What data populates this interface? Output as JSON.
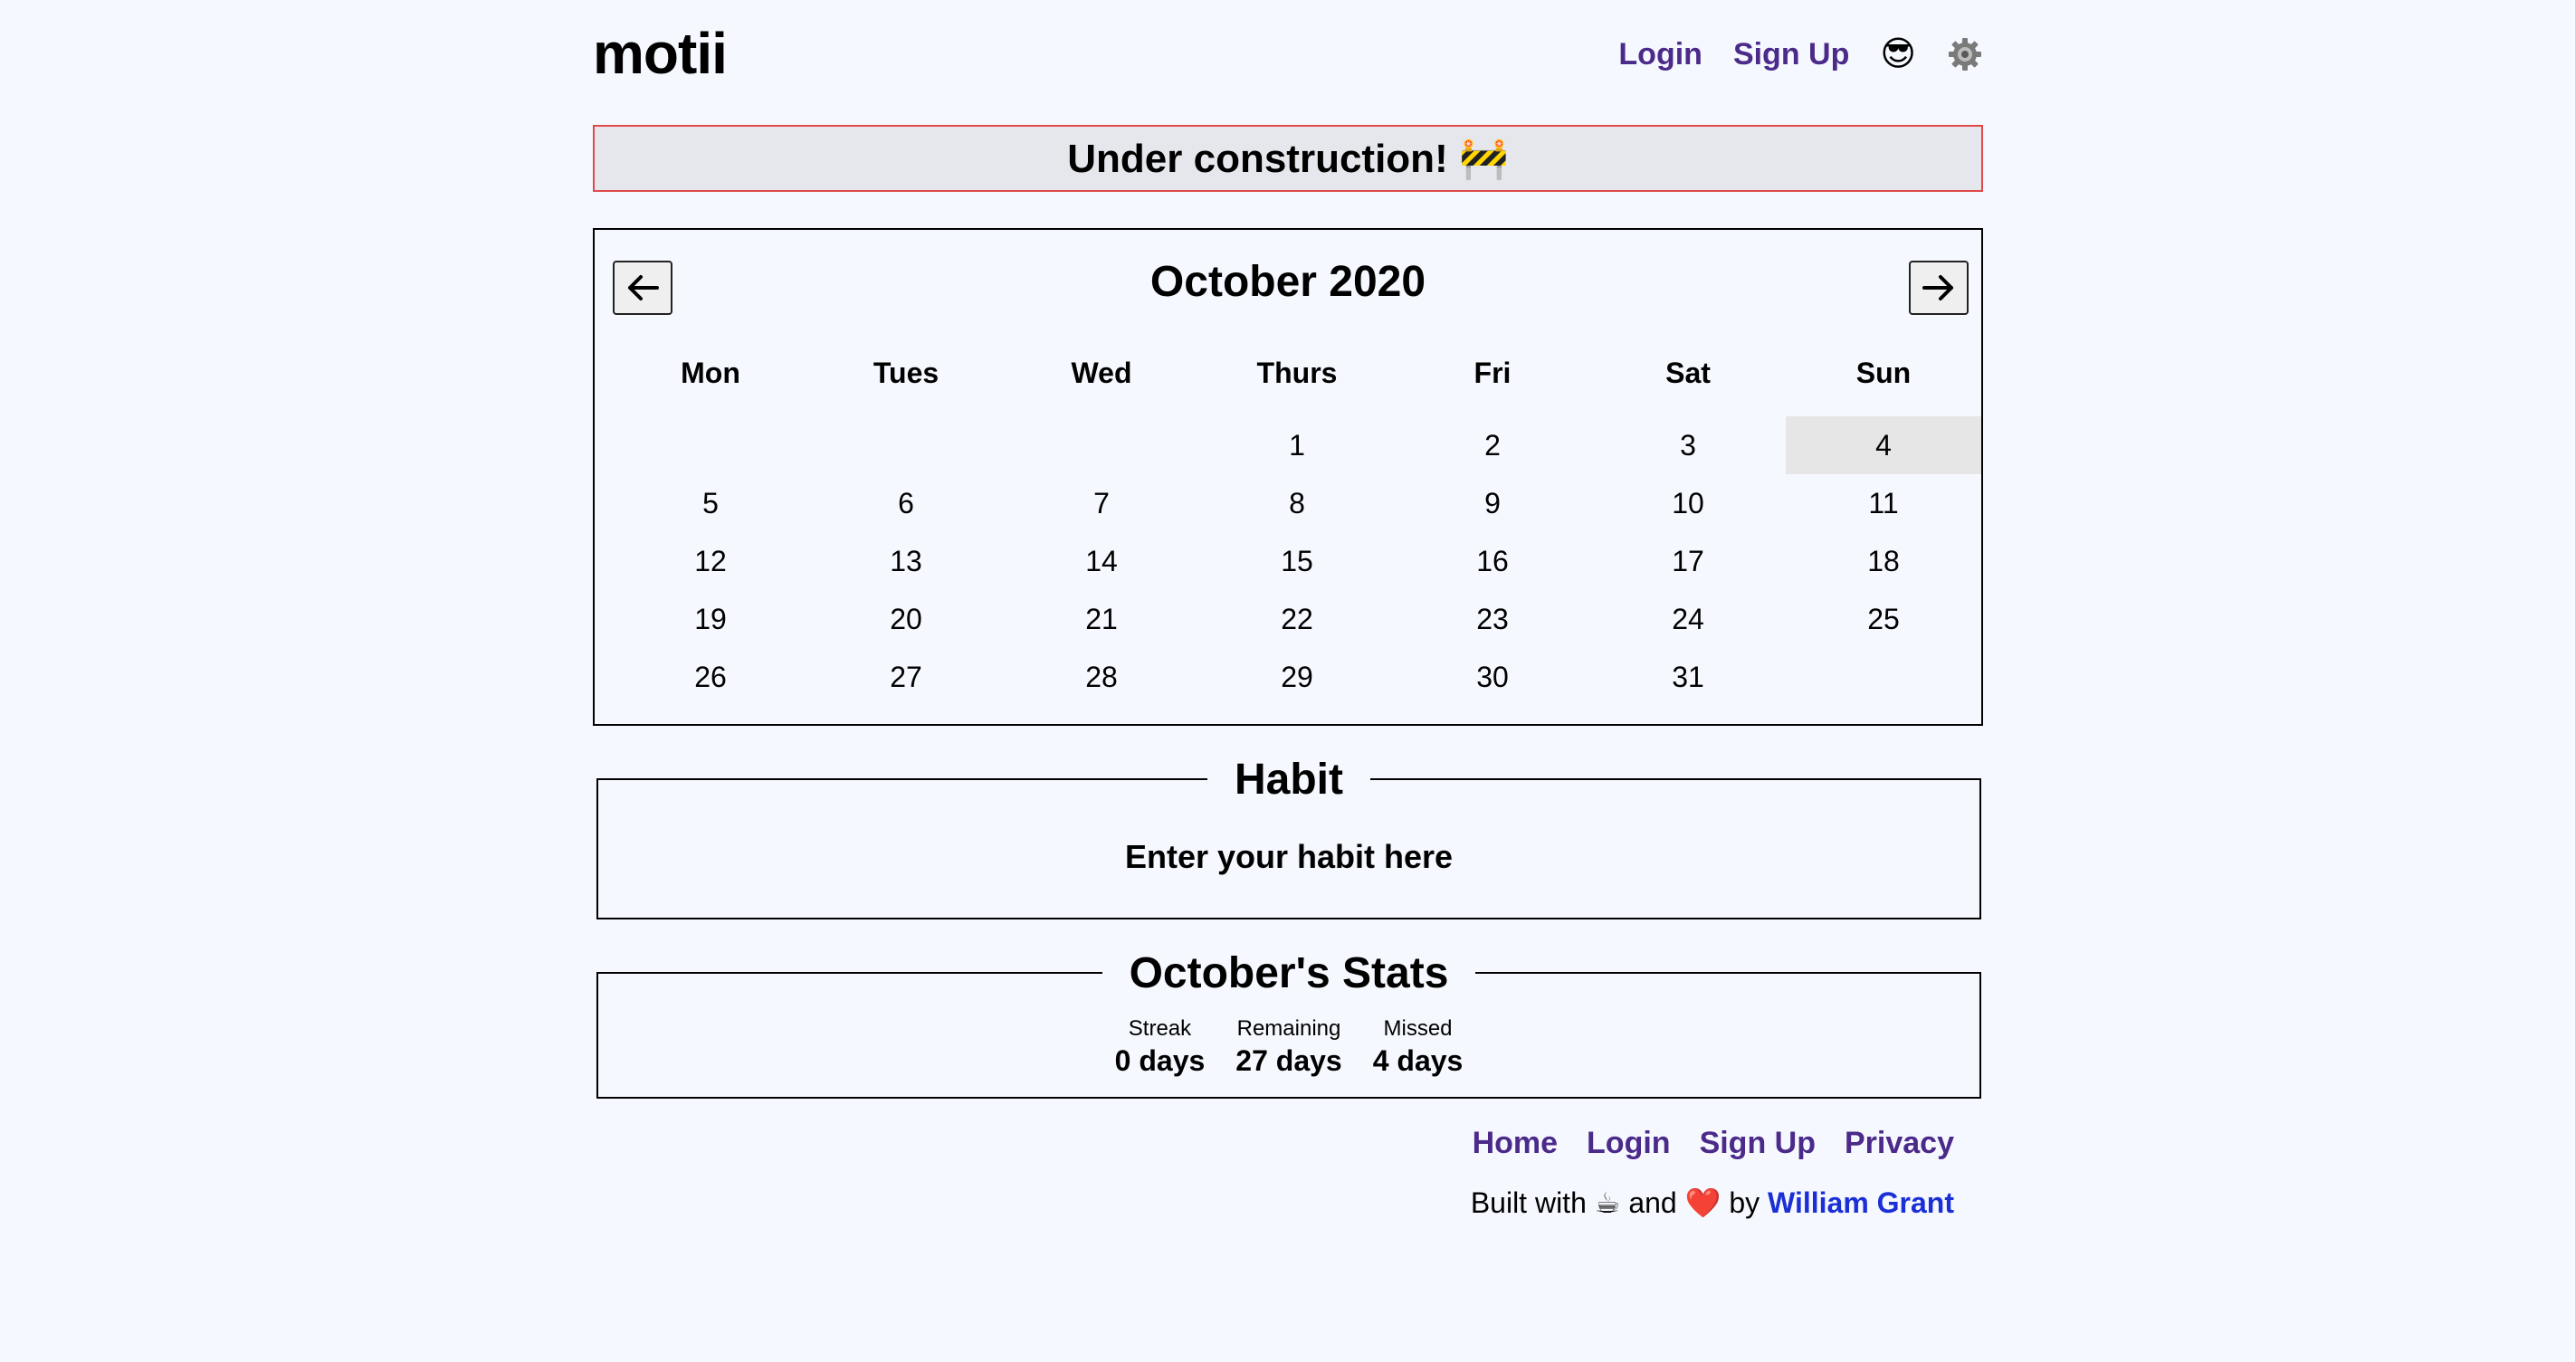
{
  "header": {
    "brand": "motii",
    "nav": {
      "login": "Login",
      "signup": "Sign Up",
      "theme_emoji": "😎",
      "settings_icon": "gear-icon"
    }
  },
  "banner": {
    "text": "Under construction! 🚧"
  },
  "calendar": {
    "title": "October 2020",
    "prev_icon": "arrow-left-icon",
    "next_icon": "arrow-right-icon",
    "weekdays": [
      "Mon",
      "Tues",
      "Wed",
      "Thurs",
      "Fri",
      "Sat",
      "Sun"
    ],
    "weeks": [
      [
        "",
        "",
        "",
        "1",
        "2",
        "3",
        "4"
      ],
      [
        "5",
        "6",
        "7",
        "8",
        "9",
        "10",
        "11"
      ],
      [
        "12",
        "13",
        "14",
        "15",
        "16",
        "17",
        "18"
      ],
      [
        "19",
        "20",
        "21",
        "22",
        "23",
        "24",
        "25"
      ],
      [
        "26",
        "27",
        "28",
        "29",
        "30",
        "31",
        ""
      ]
    ],
    "today": "4",
    "today_highlight": "#e6e6e6"
  },
  "habit": {
    "legend": "Habit",
    "placeholder": "Enter your habit here"
  },
  "stats": {
    "legend": "October's Stats",
    "items": [
      {
        "label": "Streak",
        "value": "0 days"
      },
      {
        "label": "Remaining",
        "value": "27 days"
      },
      {
        "label": "Missed",
        "value": "4 days"
      }
    ]
  },
  "footer": {
    "links": [
      "Home",
      "Login",
      "Sign Up",
      "Privacy"
    ],
    "credit_prefix": "Built with ☕ and ❤️ by",
    "author": "William Grant"
  },
  "colors": {
    "background": "#f5f8fe",
    "link": "#4b2a8a",
    "author_link": "#1a2fd6",
    "banner_border": "#e04a4a",
    "banner_bg": "#e6e7ec"
  }
}
